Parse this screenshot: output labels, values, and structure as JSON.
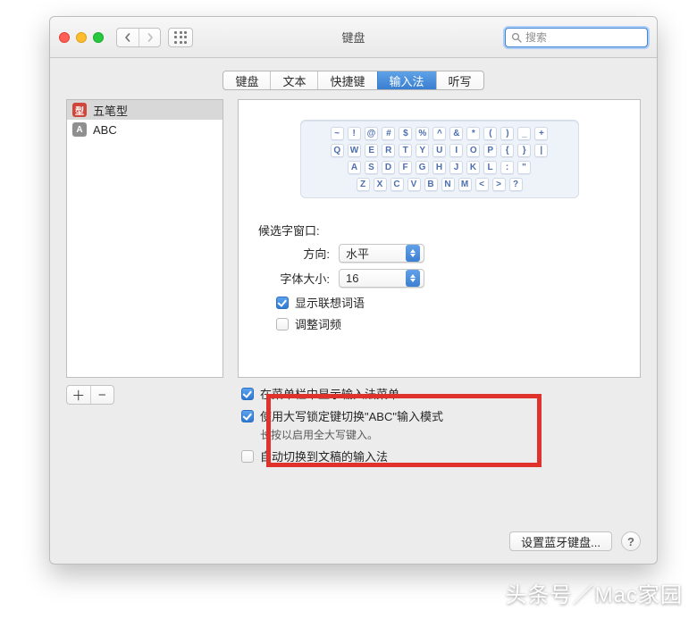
{
  "window": {
    "title": "键盘"
  },
  "toolbar": {
    "search_placeholder": "搜索"
  },
  "tabs": {
    "items": [
      "键盘",
      "文本",
      "快捷键",
      "输入法",
      "听写"
    ],
    "active_index": 3
  },
  "input_sources": {
    "items": [
      {
        "badge_text": "型",
        "badge_kind": "red",
        "label": "五笔型",
        "selected": true
      },
      {
        "badge_text": "A",
        "badge_kind": "gray",
        "label": "ABC",
        "selected": false
      }
    ]
  },
  "keyboard_rows": [
    [
      "~",
      "!",
      "@",
      "#",
      "$",
      "%",
      "^",
      "&",
      "*",
      "(",
      ")",
      "_",
      "+"
    ],
    [
      "Q",
      "W",
      "E",
      "R",
      "T",
      "Y",
      "U",
      "I",
      "O",
      "P",
      "{",
      "}",
      "|"
    ],
    [
      "A",
      "S",
      "D",
      "F",
      "G",
      "H",
      "J",
      "K",
      "L",
      ":",
      "\""
    ],
    [
      "Z",
      "X",
      "C",
      "V",
      "B",
      "N",
      "M",
      "<",
      ">",
      "?"
    ]
  ],
  "detail": {
    "section_title": "候选字窗口:",
    "direction_label": "方向:",
    "direction_value": "水平",
    "font_size_label": "字体大小:",
    "font_size_value": "16",
    "show_predictions_label": "显示联想词语",
    "show_predictions_checked": true,
    "adjust_freq_label": "调整词频",
    "adjust_freq_checked": false
  },
  "global": {
    "show_menu_label": "在菜单栏中显示输入法菜单",
    "show_menu_checked": true,
    "caps_switch_label": "使用大写锁定键切换\"ABC\"输入模式",
    "caps_switch_checked": true,
    "caps_note": "长按以启用全大写键入。",
    "auto_switch_label": "自动切换到文稿的输入法",
    "auto_switch_checked": false
  },
  "footer": {
    "bluetooth_btn": "设置蓝牙键盘..."
  },
  "watermark": "头条号／Mac家园"
}
